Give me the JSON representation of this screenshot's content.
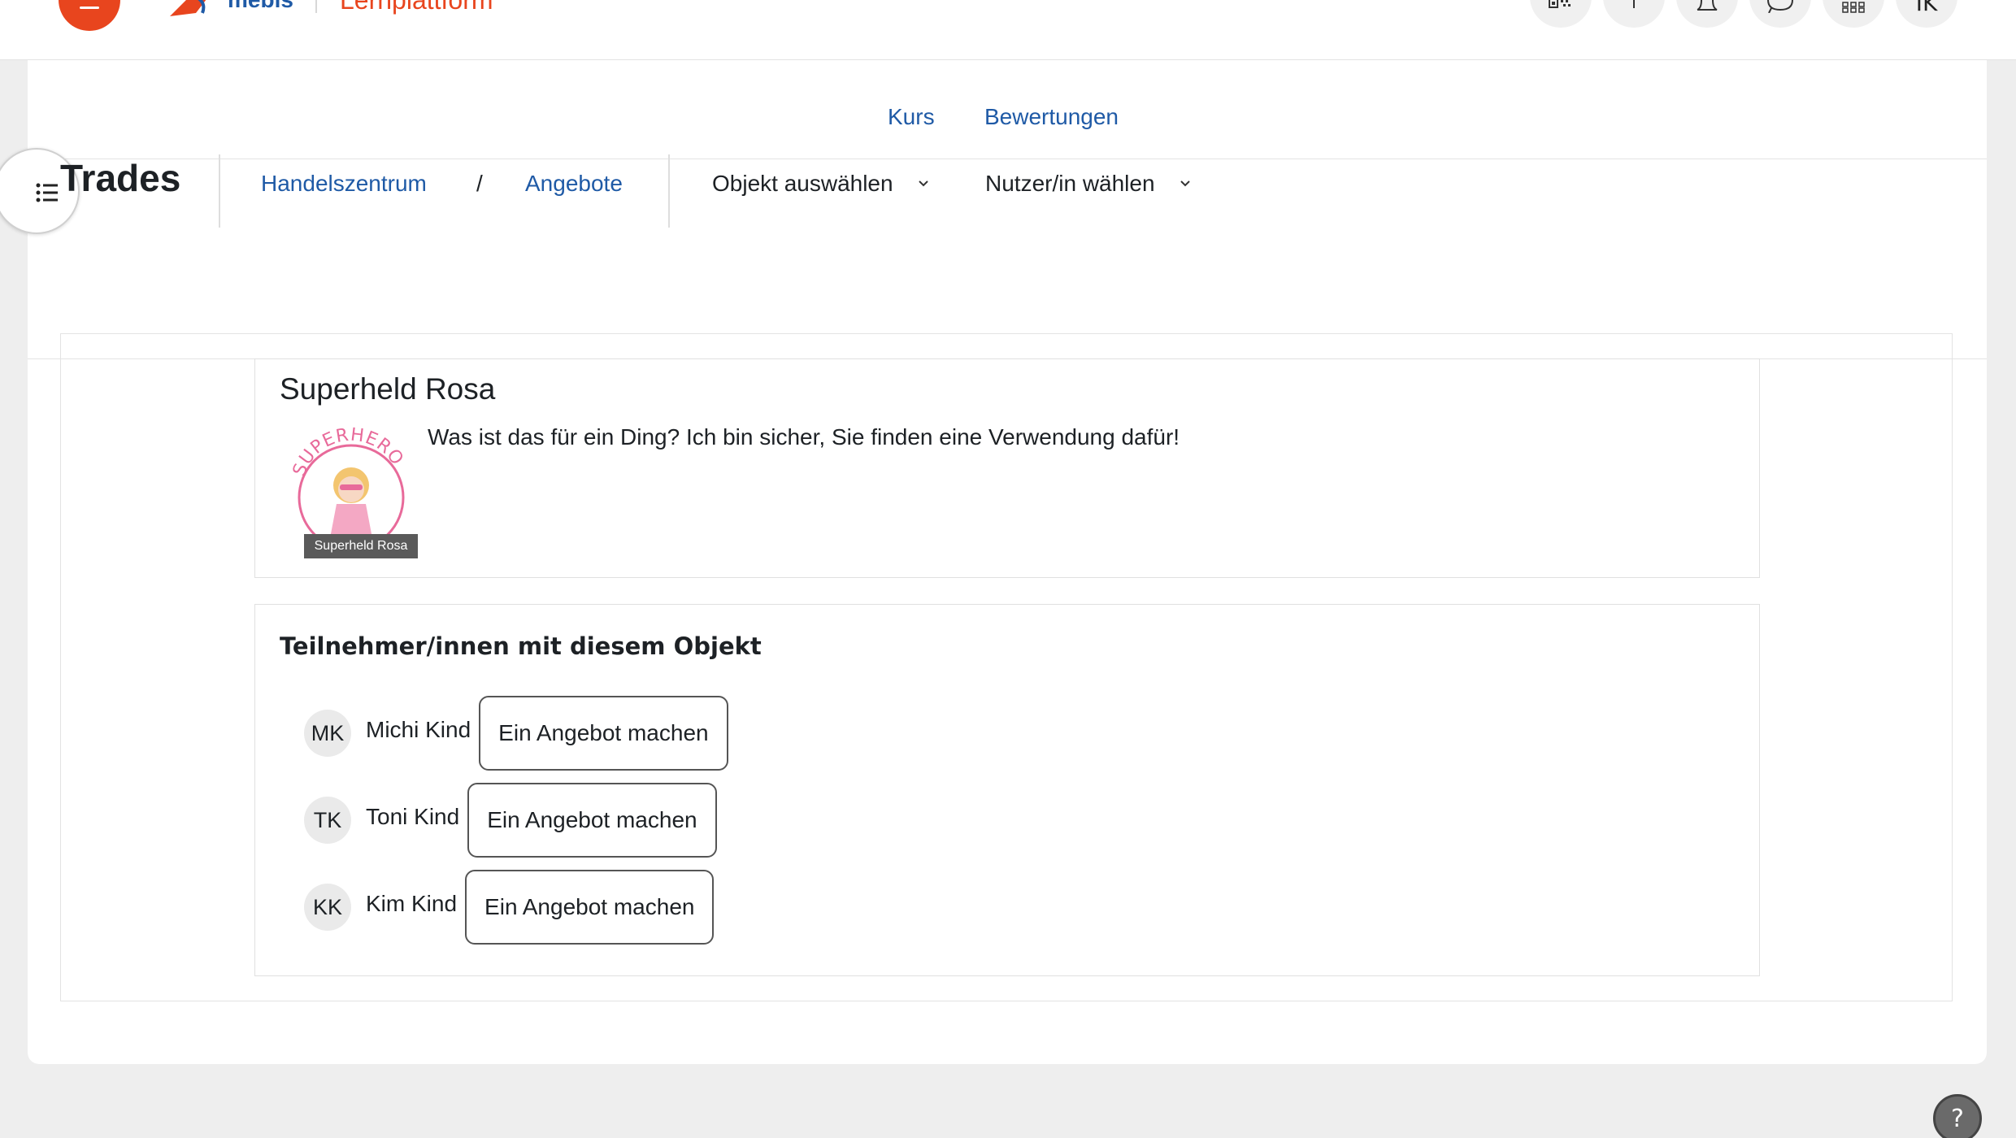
{
  "navbar": {
    "brand": "mebis",
    "platform": "Lernplattform",
    "user_initials": "IK"
  },
  "secondary_nav": {
    "course": "Kurs",
    "grades": "Bewertungen"
  },
  "header": {
    "title": "Trades",
    "breadcrumb": [
      "Handelszentrum",
      "Angebote"
    ],
    "separator": "/",
    "select_item": "Objekt auswählen",
    "select_user": "Nutzer/in wählen"
  },
  "item": {
    "name": "Superheld Rosa",
    "image_caption": "Superheld Rosa",
    "image_text": "SUPERHERO",
    "description": "Was ist das für ein Ding? Ich bin sicher, Sie finden eine Verwendung dafür!"
  },
  "members": {
    "heading": "Teilnehmer/innen mit diesem Objekt",
    "offer_label": "Ein Angebot machen",
    "list": [
      {
        "initials": "MK",
        "name": "Michi Kind"
      },
      {
        "initials": "TK",
        "name": "Toni Kind"
      },
      {
        "initials": "KK",
        "name": "Kim Kind"
      }
    ]
  },
  "help": "?",
  "colors": {
    "accent": "#e8451e",
    "link": "#1f5aa6"
  }
}
